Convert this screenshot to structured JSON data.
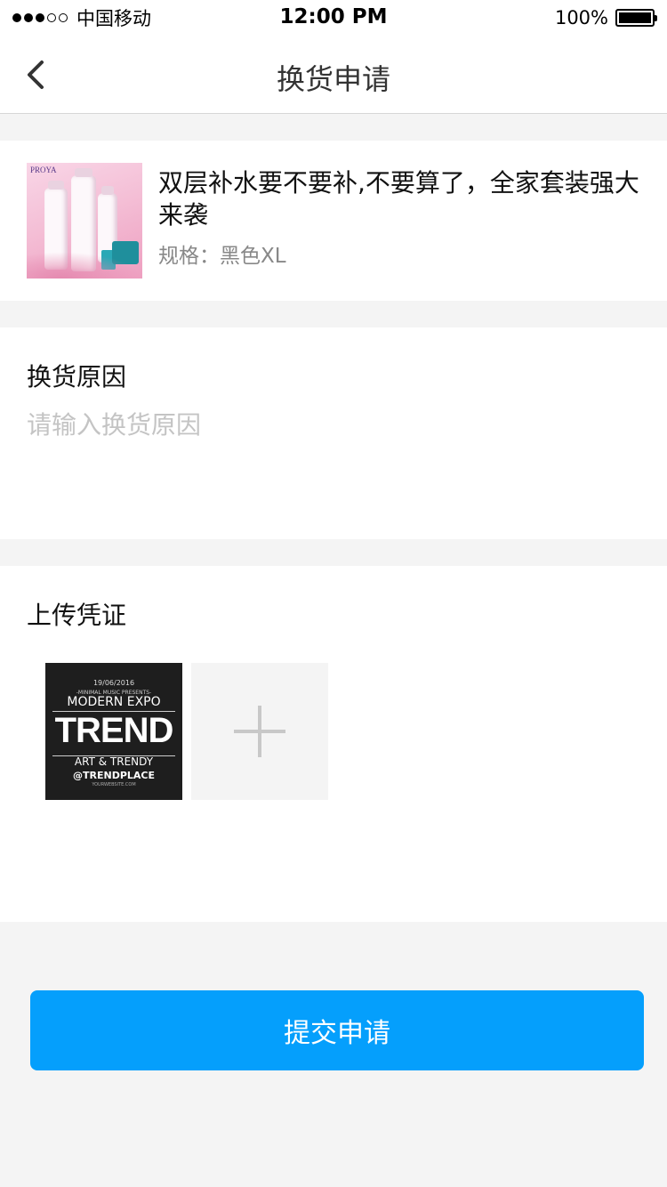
{
  "status_bar": {
    "carrier": "中国移动",
    "time": "12:00 PM",
    "battery": "100%",
    "signal_bars_filled": 3,
    "signal_bars_total": 5
  },
  "nav": {
    "title": "换货申请",
    "back_icon": "chevron-left-icon"
  },
  "product": {
    "title": "双层补水要不要补,不要算了，全家套装强大来袭",
    "spec": "规格：黑色XL",
    "thumb_brand": "PROYA"
  },
  "reason": {
    "label": "换货原因",
    "value": "",
    "placeholder": "请输入换货原因"
  },
  "upload": {
    "label": "上传凭证",
    "photos": [
      {
        "date": "19/06/2016",
        "subtitle": "-MINIMAL MUSIC PRESENTS-",
        "heading": "MODERN EXPO",
        "main": "TREND",
        "tagline": "ART & TRENDY",
        "handle": "@TRENDPLACE",
        "site": "YOURWEBSITE.COM"
      }
    ],
    "add_icon": "plus-icon"
  },
  "submit": {
    "label": "提交申请"
  },
  "colors": {
    "accent": "#059ffc",
    "background": "#f4f4f4",
    "card": "#ffffff",
    "placeholder": "#c4c4c4",
    "secondary_text": "#888888"
  }
}
